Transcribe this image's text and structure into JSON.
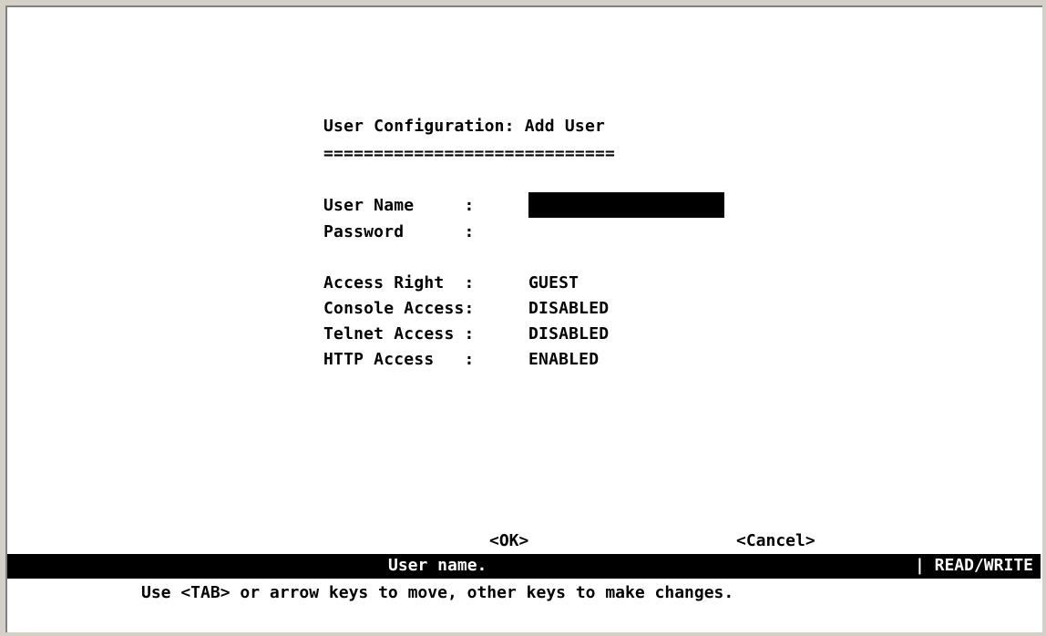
{
  "screen": {
    "title": "User Configuration: Add User",
    "title_underline": "============================="
  },
  "form": {
    "fields": [
      {
        "label": "User Name     :",
        "value": ""
      },
      {
        "label": "Password      :",
        "value": ""
      },
      {
        "label": "Access Right  :",
        "value": "GUEST"
      },
      {
        "label": "Console Access:",
        "value": "DISABLED"
      },
      {
        "label": "Telnet Access :",
        "value": "DISABLED"
      },
      {
        "label": "HTTP Access   :",
        "value": "ENABLED"
      }
    ]
  },
  "buttons": {
    "ok": "<OK>",
    "cancel": "<Cancel>"
  },
  "statusbar": {
    "message": "User name.",
    "mode": "| READ/WRITE"
  },
  "help_text": "Use <TAB> or arrow keys to move, other keys to make changes."
}
